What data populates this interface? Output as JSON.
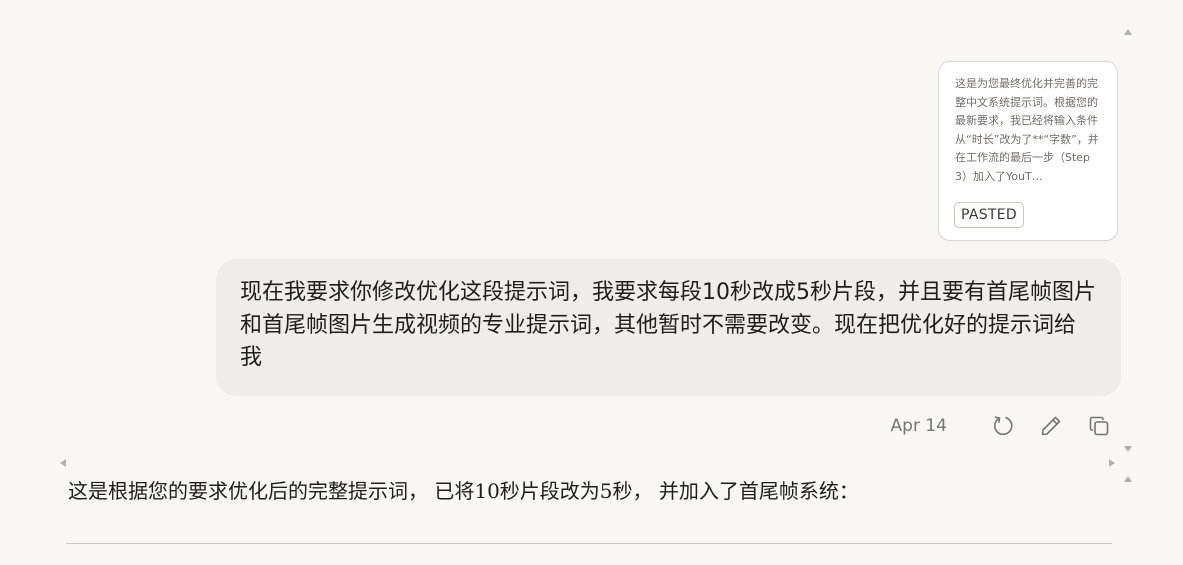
{
  "pasted_card": {
    "preview_text": "这是为您最终优化并完善的完整中文系统提示词。根据您的最新要求，我已经将输入条件从“时长”改为了**“字数”，并在工作流的最后一步（Step 3）加入了YouT…",
    "badge_label": "PASTED"
  },
  "user_message": {
    "text": "现在我要求你修改优化这段提示词，我要求每段10秒改成5秒片段，并且要有首尾帧图片和首尾帧图片生成视频的专业提示词，其他暂时不需要改变。现在把优化好的提示词给我",
    "date": "Apr 14"
  },
  "actions": {
    "retry_icon": "retry-icon",
    "edit_icon": "pencil-icon",
    "copy_icon": "copy-icon"
  },
  "assistant_message": {
    "text": "这是根据您的要求优化后的完整提示词， 已将10秒片段改为5秒， 并加入了首尾帧系统："
  },
  "colors": {
    "background": "#f8f7f4",
    "user_bubble": "#efedea",
    "card": "#ffffff",
    "muted_text": "#77756f"
  }
}
